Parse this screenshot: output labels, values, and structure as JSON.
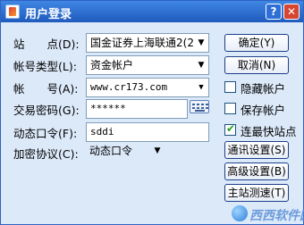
{
  "window": {
    "title": "用户登录",
    "help_label": "?",
    "close_label": "✕"
  },
  "form": {
    "site": {
      "label": "站　　点(D):",
      "value": "国金证券上海联通2(2",
      "arrow": "▼"
    },
    "account_type": {
      "label": "帐号类型(L):",
      "value": "资金帐户",
      "arrow": "▼"
    },
    "account": {
      "label": "帐　　号(A):",
      "value": "www.cr173.com",
      "arrow": "▼"
    },
    "password": {
      "label": "交易密码(G):",
      "value": "******"
    },
    "dynamic_code": {
      "label": "动态口令(F):",
      "value": "sddi"
    },
    "encryption": {
      "label": "加密协议(C):",
      "value": "动态口令",
      "arrow": "▼"
    }
  },
  "buttons": {
    "confirm": "确定(Y)",
    "cancel": "取消(N)",
    "comm_settings": "通讯设置(S)",
    "advanced_settings": "高级设置(B)",
    "site_speed_test": "主站测速(T)"
  },
  "checkboxes": {
    "hide_account": {
      "label": "隐藏帐户",
      "checked": false
    },
    "save_account": {
      "label": "保存帐户",
      "checked": false
    },
    "fastest_site": {
      "label": "连最快站点",
      "checked": true,
      "mark": "✔"
    }
  },
  "watermark": {
    "text": "西西软件园"
  },
  "colors": {
    "titlebar": "#1f5bbd",
    "window_bg": "#dce9f9",
    "button_border": "#1c3f8a"
  }
}
